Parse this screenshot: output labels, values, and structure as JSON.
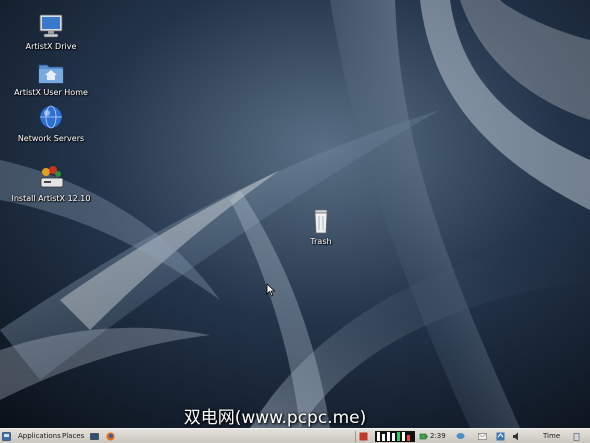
{
  "desktop": {
    "icons": [
      {
        "label": "ArtistX Drive",
        "icon": "computer-drive-icon"
      },
      {
        "label": "ArtistX User Home",
        "icon": "home-folder-icon"
      },
      {
        "label": "Network Servers",
        "icon": "network-globe-icon"
      },
      {
        "label": "Install ArtistX 12.10",
        "icon": "installer-icon"
      },
      {
        "label": "Trash",
        "icon": "trash-icon"
      }
    ],
    "watermark": "双电网(www.pcpc.me)"
  },
  "panel": {
    "applications": "Applications",
    "places": "Places",
    "clock_small": "2:39",
    "time_label": "Time"
  },
  "colors": {
    "wallpaper_dark": "#0d1620",
    "wallpaper_light": "#9fb3c6",
    "panel": "#d8d5ce"
  }
}
